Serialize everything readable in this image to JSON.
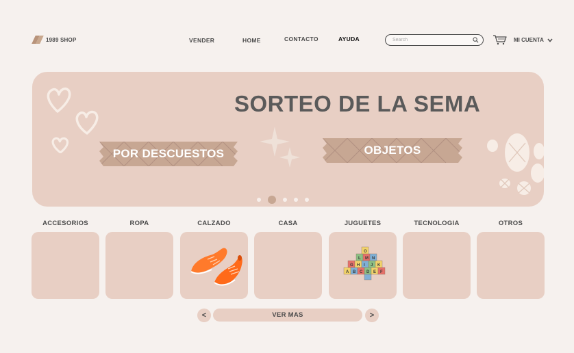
{
  "header": {
    "logo_text": "1989 SHOP",
    "nav": [
      {
        "label": "VENDER"
      },
      {
        "label": "HOME"
      },
      {
        "label": "CONTACTO"
      },
      {
        "label": "AYUDA"
      }
    ],
    "search_placeholder": "Search",
    "account_label": "MI CUENTA"
  },
  "banner": {
    "title": "SORTEO DE LA SEMA",
    "tape_left": "POR DESCUESTOS",
    "tape_right": "OBJETOS",
    "slide_count": 5,
    "active_slide": 2
  },
  "categories": [
    {
      "label": "ACCESORIOS",
      "image": ""
    },
    {
      "label": "ROPA",
      "image": ""
    },
    {
      "label": "CALZADO",
      "image": "orange-sneakers"
    },
    {
      "label": "CASA",
      "image": ""
    },
    {
      "label": "JUGUETES",
      "image": "toy-blocks"
    },
    {
      "label": "TECNOLOGIA",
      "image": ""
    },
    {
      "label": "OTROS",
      "image": ""
    }
  ],
  "pager": {
    "prev": "<",
    "next": ">",
    "ver_mas": "VER MAS"
  },
  "colors": {
    "background": "#f6f1ee",
    "card": "#e8cfc4",
    "tape": "#c7a793",
    "text": "#4a4a4a"
  }
}
